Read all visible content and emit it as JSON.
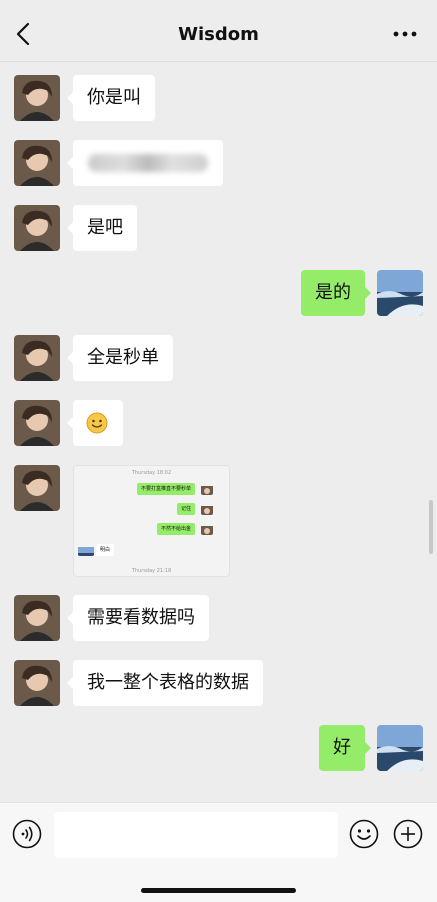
{
  "header": {
    "title": "Wisdom"
  },
  "messages": [
    {
      "side": "in",
      "text": "你是叫"
    },
    {
      "side": "in",
      "text": ""
    },
    {
      "side": "in",
      "text": "是吧"
    },
    {
      "side": "out",
      "text": "是的"
    },
    {
      "side": "in",
      "text": "全是秒单"
    },
    {
      "side": "in",
      "text": ""
    },
    {
      "side": "in",
      "text": ""
    },
    {
      "side": "in",
      "text": "需要看数据吗"
    },
    {
      "side": "in",
      "text": "我一整个表格的数据"
    },
    {
      "side": "out",
      "text": "好"
    }
  ],
  "embedded_screenshot": {
    "time_top": "Thursday 18:02",
    "msg1": "不要打盒推直不要秒单",
    "msg2": "记住",
    "msg3": "不然不给出金",
    "reply": "明白",
    "time_bottom": "Thursday 21:18"
  },
  "colors": {
    "accent": "#95ec69",
    "background": "#ededed"
  },
  "icons": [
    "back-arrow-icon",
    "more-icon",
    "voice-icon",
    "emoji-icon",
    "plus-icon"
  ]
}
